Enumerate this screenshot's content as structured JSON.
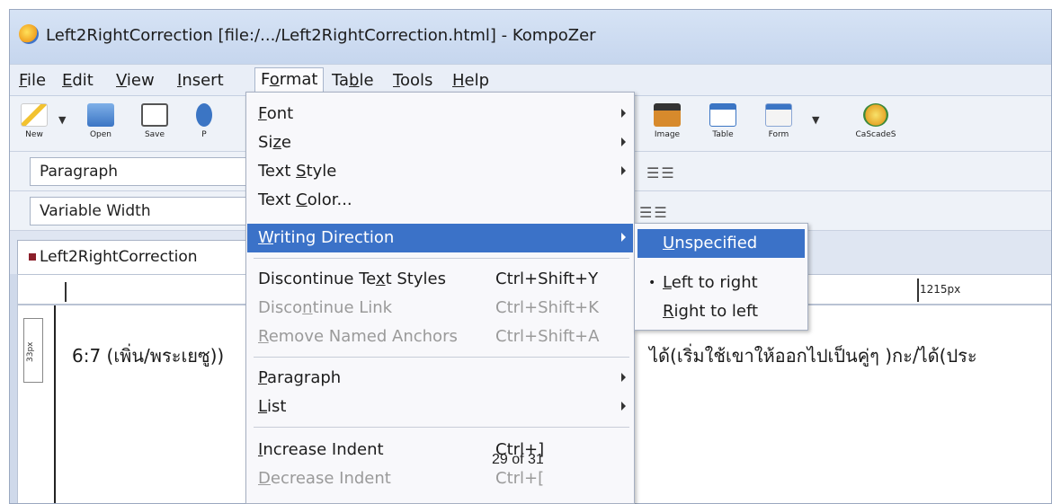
{
  "window": {
    "title": "Left2RightCorrection [file:/.../Left2RightCorrection.html] - KompoZer"
  },
  "menubar": [
    {
      "pre": "",
      "u": "F",
      "post": "ile"
    },
    {
      "pre": "",
      "u": "E",
      "post": "dit"
    },
    {
      "pre": "",
      "u": "V",
      "post": "iew"
    },
    {
      "pre": "",
      "u": "I",
      "post": "nsert"
    },
    {
      "pre": "F",
      "u": "o",
      "post": "rmat"
    },
    {
      "pre": "Ta",
      "u": "b",
      "post": "le"
    },
    {
      "pre": "",
      "u": "T",
      "post": "ools"
    },
    {
      "pre": "",
      "u": "H",
      "post": "elp"
    }
  ],
  "toolbar": {
    "new": "New",
    "open": "Open",
    "save": "Save",
    "publish_partial": "P",
    "image": "Image",
    "table": "Table",
    "form": "Form",
    "cascades": "CaScadeS"
  },
  "format_toolbar": {
    "paragraph_select": "Paragraph",
    "font_select": "Variable Width"
  },
  "tab": {
    "label": "Left2RightCorrection"
  },
  "ruler": {
    "width_label": "1215px",
    "height_label": "33px"
  },
  "editor": {
    "text_left": "6:7 (เพิ่น/พระเยซู))",
    "text_right": "ได้(เริ่มใช้เขาให้ออกไปเป็นคู่ๆ )กะ/ได้(ประ"
  },
  "format_menu": {
    "items": [
      {
        "pre": "",
        "u": "F",
        "post": "ont",
        "shortcut": ""
      },
      {
        "pre": "Si",
        "u": "z",
        "post": "e",
        "shortcut": ""
      },
      {
        "pre": "Text ",
        "u": "S",
        "post": "tyle",
        "shortcut": ""
      },
      {
        "pre": "Text ",
        "u": "C",
        "post": "olor...",
        "shortcut": ""
      },
      {
        "pre": "",
        "u": "W",
        "post": "riting Direction",
        "shortcut": ""
      },
      {
        "pre": "Discontinue Te",
        "u": "x",
        "post": "t Styles",
        "shortcut": "Ctrl+Shift+Y"
      },
      {
        "pre": "Disco",
        "u": "n",
        "post": "tinue Link",
        "shortcut": "Ctrl+Shift+K"
      },
      {
        "pre": "",
        "u": "R",
        "post": "emove Named Anchors",
        "shortcut": "Ctrl+Shift+A"
      },
      {
        "pre": "",
        "u": "P",
        "post": "aragraph",
        "shortcut": ""
      },
      {
        "pre": "",
        "u": "L",
        "post": "ist",
        "shortcut": ""
      },
      {
        "pre": "",
        "u": "I",
        "post": "ncrease Indent",
        "shortcut": "Ctrl+]"
      },
      {
        "pre": "",
        "u": "D",
        "post": "ecrease Indent",
        "shortcut": "Ctrl+["
      }
    ]
  },
  "writing_direction_submenu": [
    {
      "pre": "",
      "u": "U",
      "post": "nspecified"
    },
    {
      "pre": "",
      "u": "L",
      "post": "eft to right"
    },
    {
      "pre": "",
      "u": "R",
      "post": "ight to left"
    }
  ],
  "footer": {
    "page_count": "29 of 31"
  }
}
